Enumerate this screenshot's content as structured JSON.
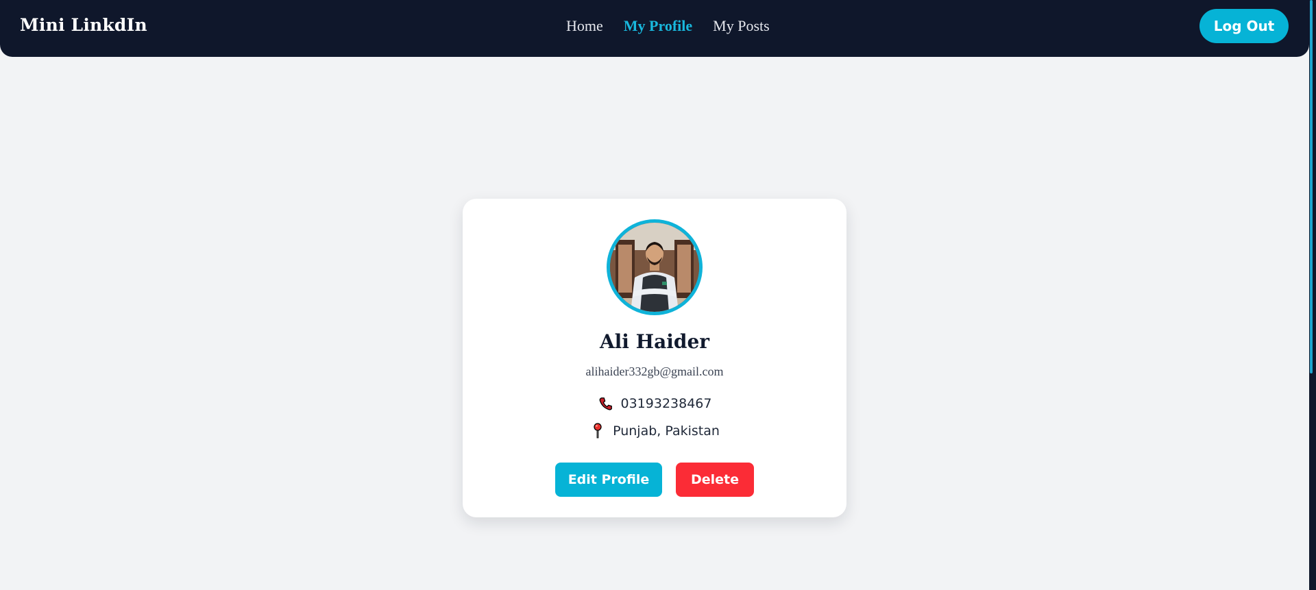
{
  "navbar": {
    "brand": "Mini LinkdIn",
    "links": [
      {
        "label": "Home",
        "active": false
      },
      {
        "label": "My Profile",
        "active": true
      },
      {
        "label": "My Posts",
        "active": false
      }
    ],
    "logout_label": "Log Out"
  },
  "profile": {
    "name": "Ali Haider",
    "email": "alihaider332gb@gmail.com",
    "phone": "03193238467",
    "location": "Punjab, Pakistan",
    "phone_icon": "phone-icon",
    "location_icon": "map-pin-icon"
  },
  "actions": {
    "edit_label": "Edit Profile",
    "delete_label": "Delete"
  },
  "colors": {
    "nav_bg": "#0f172b",
    "accent": "#06b3d6",
    "danger": "#fb2c36",
    "page_bg": "#f2f3f5"
  }
}
